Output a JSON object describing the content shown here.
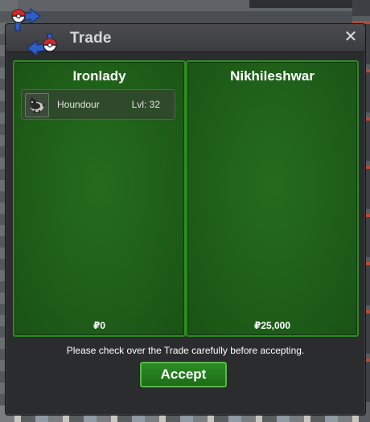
{
  "window": {
    "title": "Trade",
    "close_glyph": "✕",
    "logo_icon": "pokeball-swap-icon"
  },
  "left_panel": {
    "player_name": "Ironlady",
    "money": "₽0",
    "pokemon": [
      {
        "name": "Houndour",
        "level": "Lvl: 32",
        "icon": "houndour-icon"
      }
    ]
  },
  "right_panel": {
    "player_name": "Nikhileshwar",
    "money": "₽25,000",
    "pokemon": []
  },
  "note": "Please check over the Trade carefully before accepting.",
  "accept_label": "Accept",
  "colors": {
    "panel_green": "#1f5f19",
    "panel_border": "#2f8a23",
    "button_green": "#2d8c25",
    "window_bg": "#2b2c2e",
    "titlebar": "#3f4144"
  }
}
